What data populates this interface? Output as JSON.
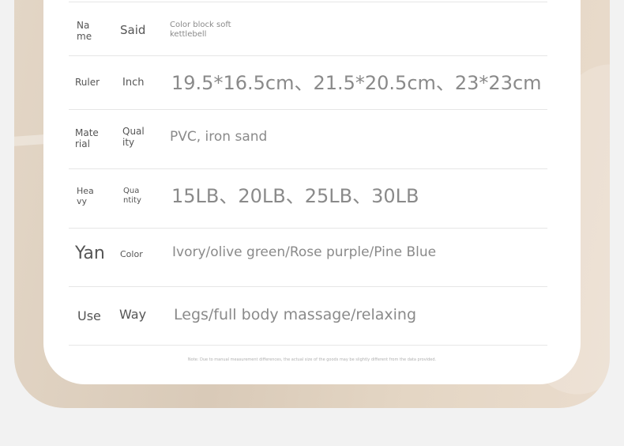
{
  "rows": [
    {
      "k1": "Na\nme",
      "k2": "Said",
      "value": "Color block soft\nkettlebell"
    },
    {
      "k1": "Ruler",
      "k2": "Inch",
      "value": "19.5*16.5cm、21.5*20.5cm、23*23cm"
    },
    {
      "k1": "Mate\nrial",
      "k2": "Qual\nity",
      "value": "PVC, iron sand"
    },
    {
      "k1": "Hea\nvy",
      "k2": "Qua\nntity",
      "value": "15LB、20LB、25LB、30LB"
    },
    {
      "k1": "Yan",
      "k2": "Color",
      "value": "Ivory/olive green/Rose purple/Pine Blue"
    },
    {
      "k1": "Use",
      "k2": "Way",
      "value": "Legs/full body massage/relaxing"
    }
  ],
  "note": "Note: Due to manual measurement differences, the actual size of the goods may be slightly different from the data provided."
}
